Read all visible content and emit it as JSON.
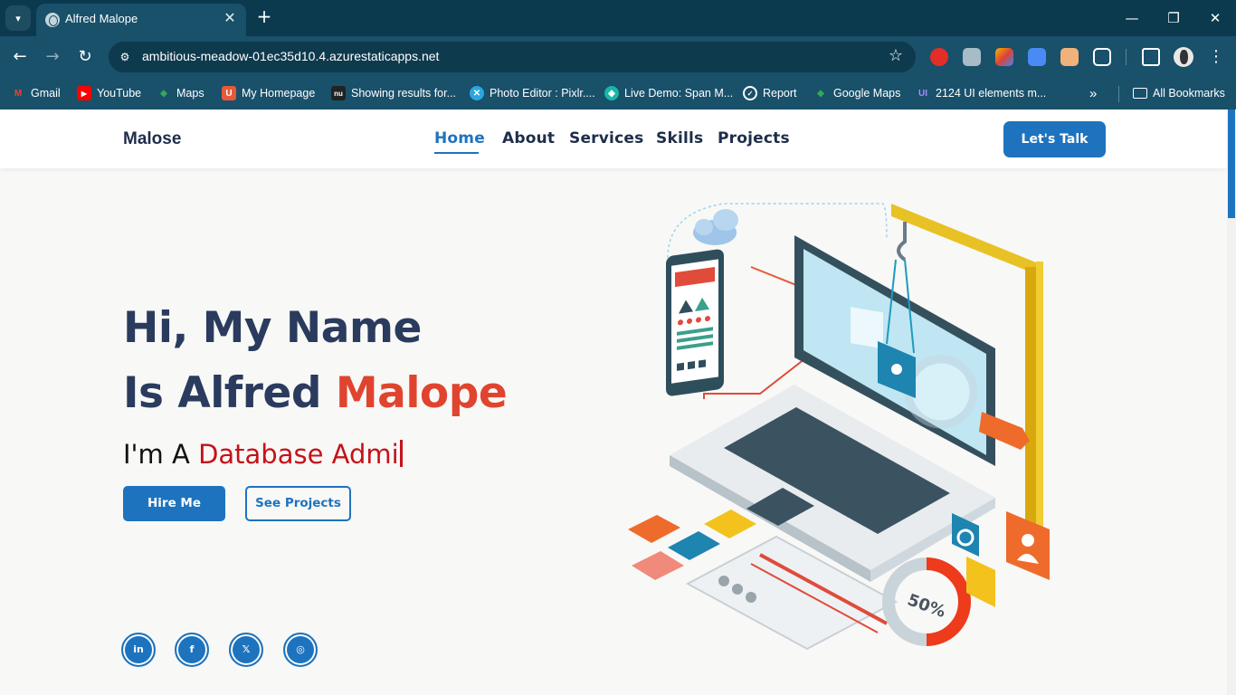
{
  "browser": {
    "tab_title": "Alfred Malope",
    "url": "ambitious-meadow-01ec35d10.4.azurestaticapps.net",
    "bookmarks": [
      {
        "label": "Gmail",
        "icon": "gmail-icon",
        "color": "#ea4335"
      },
      {
        "label": "YouTube",
        "icon": "youtube-icon",
        "color": "#ff0000"
      },
      {
        "label": "Maps",
        "icon": "maps-icon",
        "color": "#34a853"
      },
      {
        "label": "My Homepage",
        "icon": "homepage-icon",
        "color": "#e8583a"
      },
      {
        "label": "Showing results for...",
        "icon": "nu-icon",
        "color": "#222222"
      },
      {
        "label": "Photo Editor : Pixlr....",
        "icon": "pixlr-icon",
        "color": "#2aa7e0"
      },
      {
        "label": "Live Demo: Span M...",
        "icon": "span-icon",
        "color": "#18b6a8"
      },
      {
        "label": "Report",
        "icon": "report-icon",
        "color": "#ffffff"
      },
      {
        "label": "Google Maps",
        "icon": "google-maps-icon",
        "color": "#34a853"
      },
      {
        "label": "2124 UI elements m...",
        "icon": "ui-icon",
        "color": "#7b4dff"
      }
    ],
    "all_bookmarks": "All Bookmarks"
  },
  "site": {
    "logo": "Malose",
    "nav": [
      "Home",
      "About",
      "Services",
      "Skills",
      "Projects"
    ],
    "active_nav": "Home",
    "cta": "Let's Talk",
    "hero_line1": "Hi, My Name",
    "hero_line2_prefix": "Is Alfred ",
    "hero_line2_accent": "Malope",
    "typing_prefix": "I'm A ",
    "typing_role": "Database Admi",
    "hire_button": "Hire Me",
    "projects_button": "See Projects",
    "social": [
      {
        "name": "linkedin-icon",
        "glyph": "in"
      },
      {
        "name": "facebook-icon",
        "glyph": "f"
      },
      {
        "name": "x-icon",
        "glyph": "𝕏"
      },
      {
        "name": "github-icon",
        "glyph": "◎"
      }
    ],
    "illustration_gauge": "50%"
  },
  "colors": {
    "primary": "#1e73be",
    "heading": "#2a3b5e",
    "accent": "#e0442e",
    "role": "#c5121a",
    "chrome": "#19506a"
  }
}
